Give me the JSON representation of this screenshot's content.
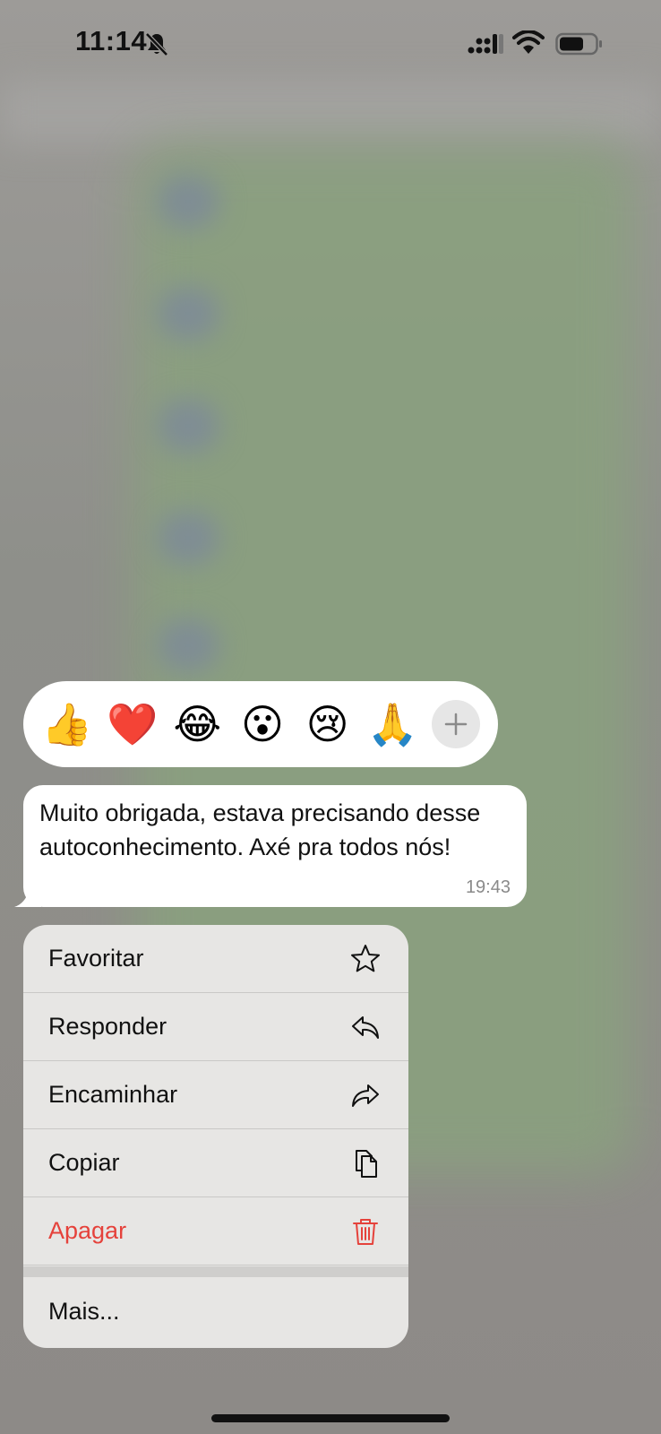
{
  "status_bar": {
    "time": "11:14"
  },
  "reactions": [
    {
      "emoji": "👍",
      "name": "thumbs-up"
    },
    {
      "emoji": "❤️",
      "name": "heart"
    },
    {
      "emoji": "😂",
      "name": "laughing"
    },
    {
      "emoji": "😮",
      "name": "surprised"
    },
    {
      "emoji": "😢",
      "name": "crying"
    },
    {
      "emoji": "🙏",
      "name": "praying-hands"
    }
  ],
  "message": {
    "text": "Muito obrigada, estava precisando desse autoconhecimento. Axé pra todos nós!",
    "time": "19:43"
  },
  "menu": {
    "favorite": "Favoritar",
    "reply": "Responder",
    "forward": "Encaminhar",
    "copy": "Copiar",
    "delete": "Apagar",
    "more": "Mais..."
  },
  "colors": {
    "danger": "#e5423b",
    "bubble": "#ffffff",
    "menu_bg": "#e7e6e4"
  }
}
